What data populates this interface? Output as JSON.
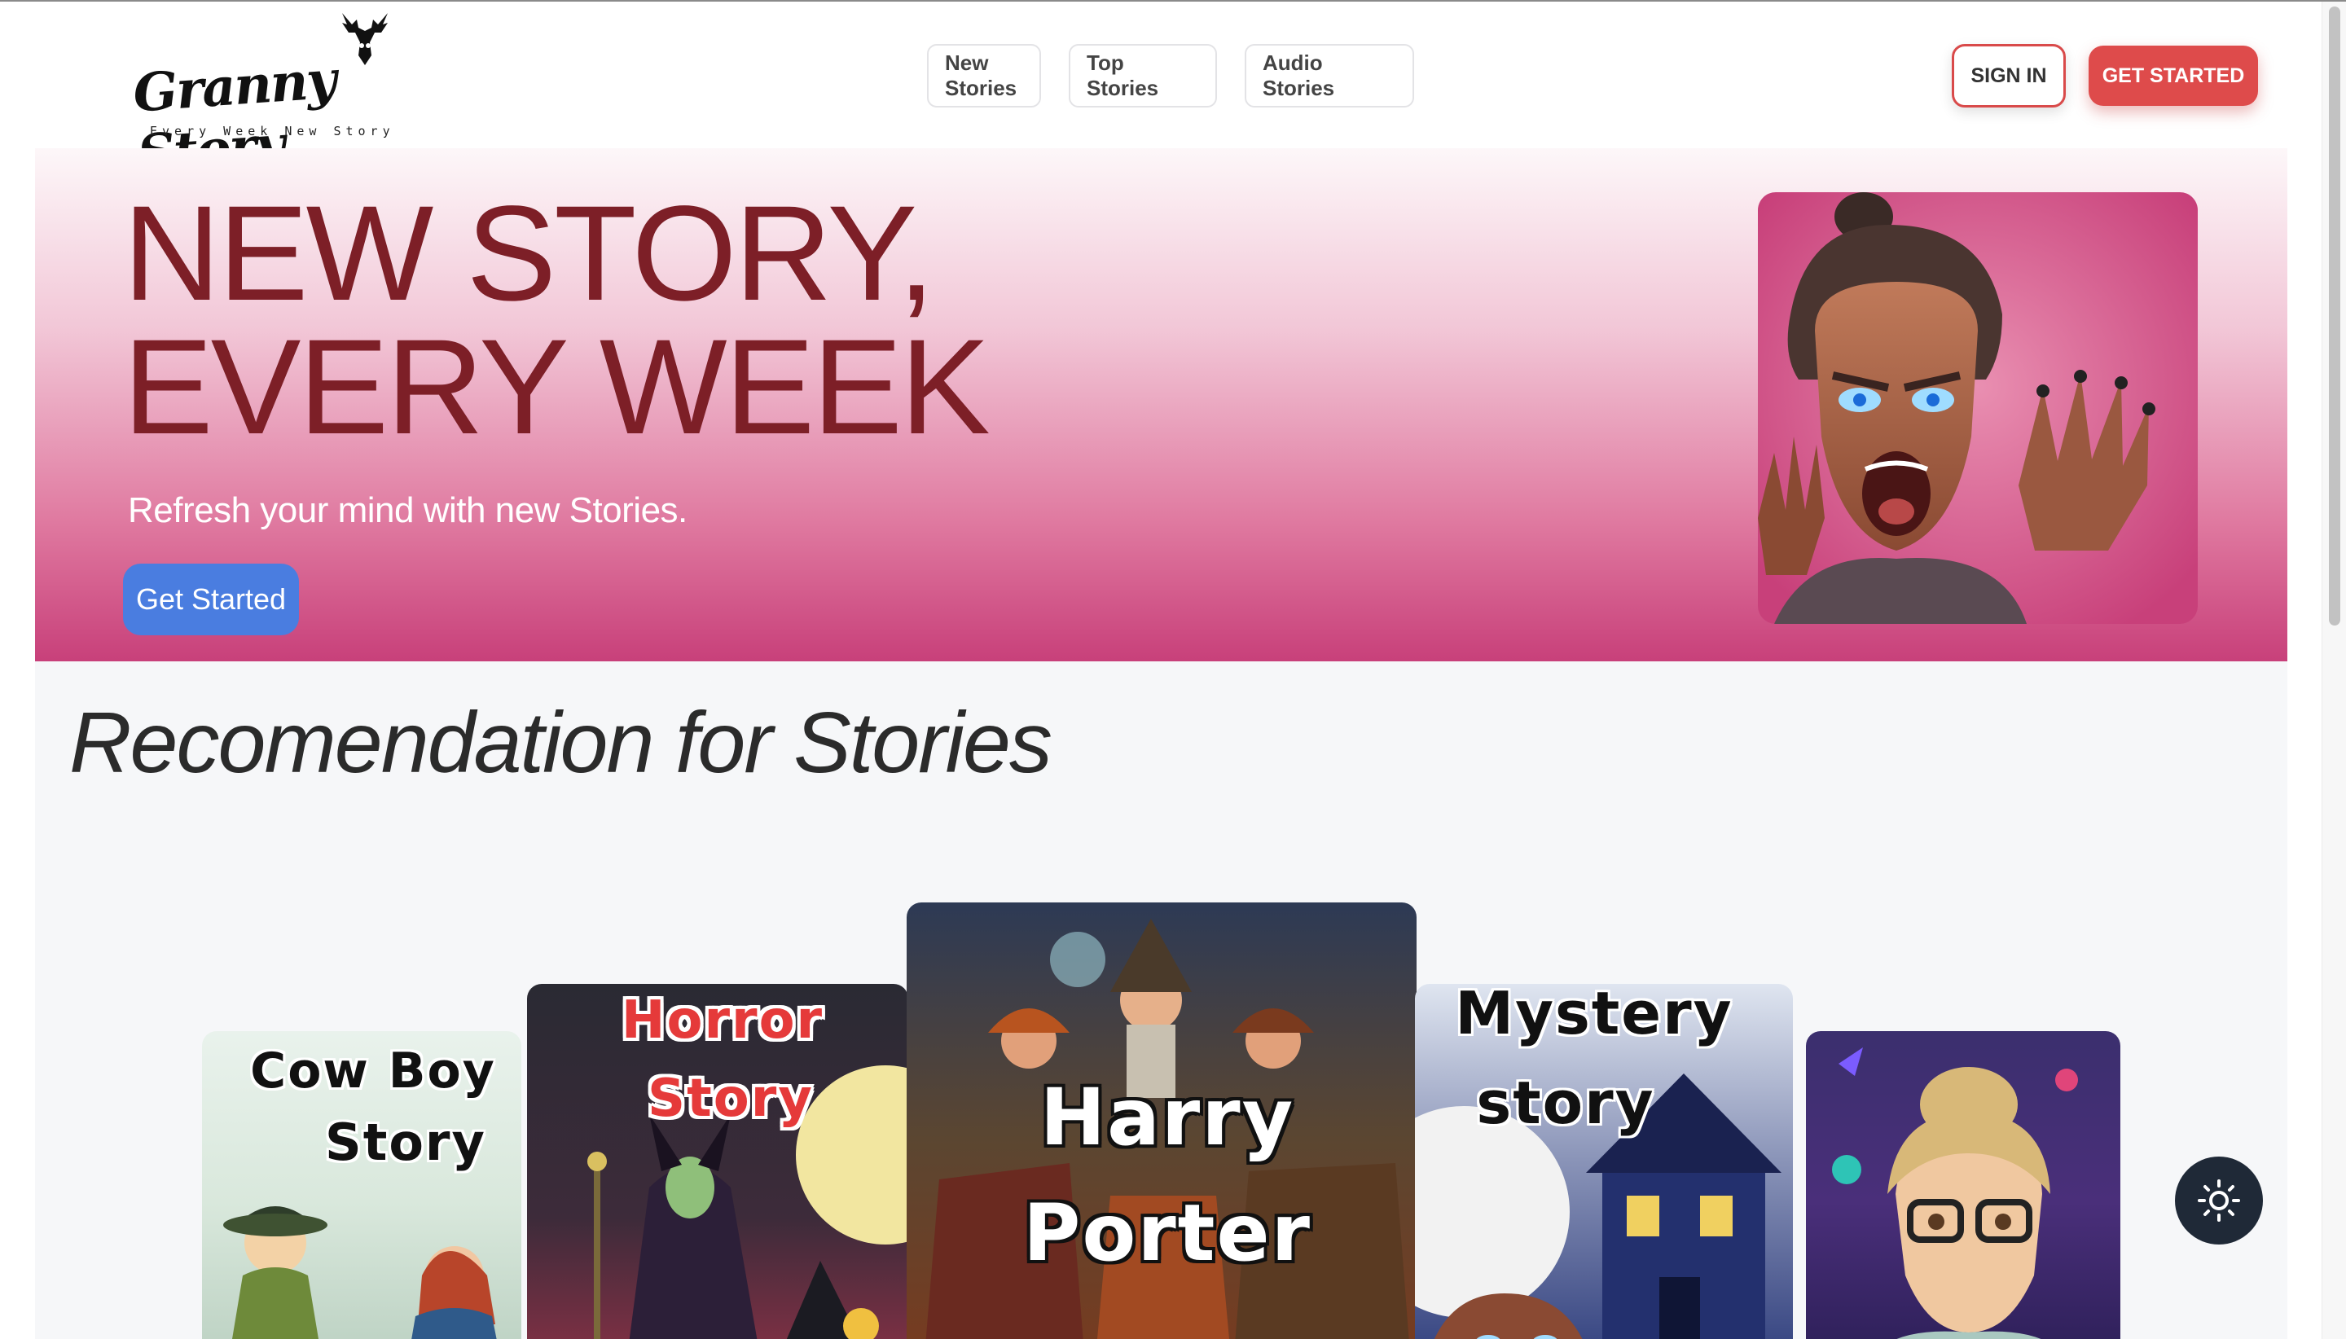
{
  "brand": {
    "name": "Granny Story",
    "tagline": "Every Week New Story"
  },
  "nav": {
    "items": [
      {
        "label": "New Stories"
      },
      {
        "label": "Top Stories"
      },
      {
        "label": "Audio Stories"
      }
    ]
  },
  "auth": {
    "sign_in_label": "SIGN IN",
    "get_started_label": "GET STARTED"
  },
  "hero": {
    "title_line1": "NEW STORY,",
    "title_line2": "EVERY WEEK",
    "subtitle": "Refresh your mind with new Stories.",
    "cta_label": "Get Started"
  },
  "recommendations": {
    "title": "Recomendation for Stories",
    "cards": [
      {
        "line1": "Cow Boy",
        "line2": "Story"
      },
      {
        "line1": "Horror",
        "line2": "Story"
      },
      {
        "line1": "Harry",
        "line2": "Porter"
      },
      {
        "line1": "Mystery",
        "line2": "story"
      },
      {
        "line1": "",
        "line2": ""
      }
    ]
  },
  "colors": {
    "accent_red": "#de4b4b",
    "hero_button_blue": "#4a7de0",
    "hero_title": "#7d1f27",
    "hero_gradient_bottom": "#c8407a",
    "theme_toggle_bg": "#1f2937"
  },
  "icons": {
    "logo": "deer-head-icon",
    "theme_toggle": "sun-icon"
  }
}
